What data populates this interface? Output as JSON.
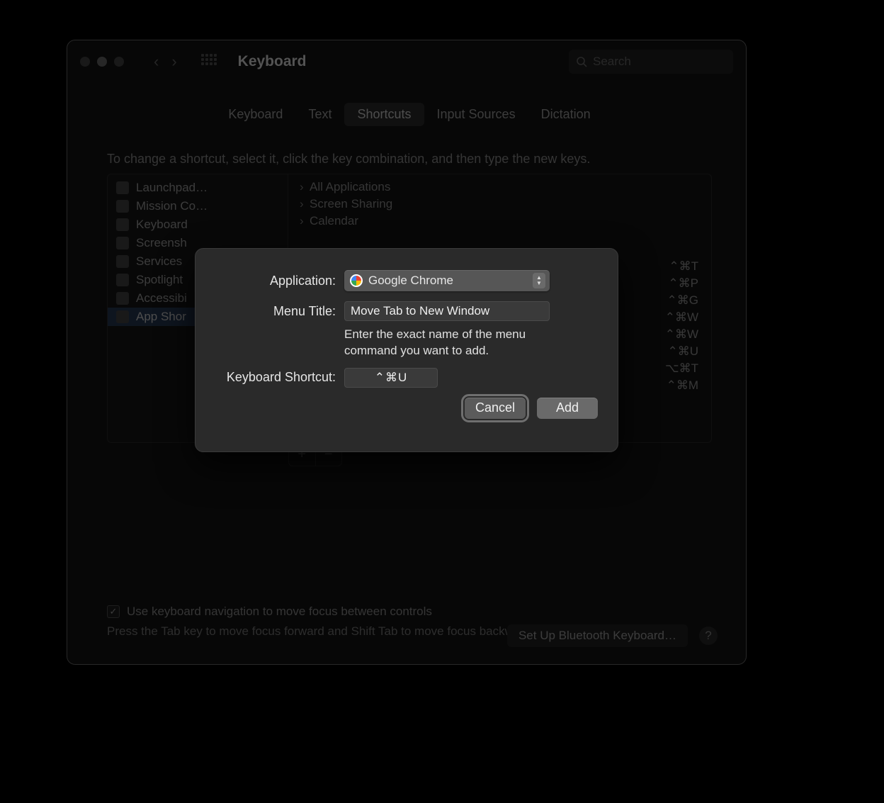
{
  "window": {
    "title": "Keyboard",
    "search_placeholder": "Search"
  },
  "tabs": [
    "Keyboard",
    "Text",
    "Shortcuts",
    "Input Sources",
    "Dictation"
  ],
  "active_tab": "Shortcuts",
  "instruction": "To change a shortcut, select it, click the key combination, and then type the new keys.",
  "sidebar": {
    "items": [
      "Launchpad…",
      "Mission Co…",
      "Keyboard",
      "Screensh",
      "Services",
      "Spotlight",
      "Accessibi",
      "App Shor"
    ],
    "selected_index": 7
  },
  "disclosure_list": [
    "All Applications",
    "Screen Sharing",
    "Calendar"
  ],
  "visible_shortcuts": [
    "⌃⌘T",
    "⌃⌘P",
    "⌃⌘G",
    "⌃⌘W",
    "⌃⌘W",
    "⌃⌘U",
    "⌥⌘T",
    "⌃⌘M"
  ],
  "checkbox_label": "Use keyboard navigation to move focus between controls",
  "hint": "Press the Tab key to move focus forward and Shift Tab to move focus backward.",
  "footer_button": "Set Up Bluetooth Keyboard…",
  "sheet": {
    "application_label": "Application:",
    "application_value": "Google Chrome",
    "menu_title_label": "Menu Title:",
    "menu_title_value": "Move Tab to New Window",
    "helper": "Enter the exact name of the menu command you want to add.",
    "shortcut_label": "Keyboard Shortcut:",
    "shortcut_value": "⌃⌘U",
    "cancel": "Cancel",
    "add": "Add"
  }
}
